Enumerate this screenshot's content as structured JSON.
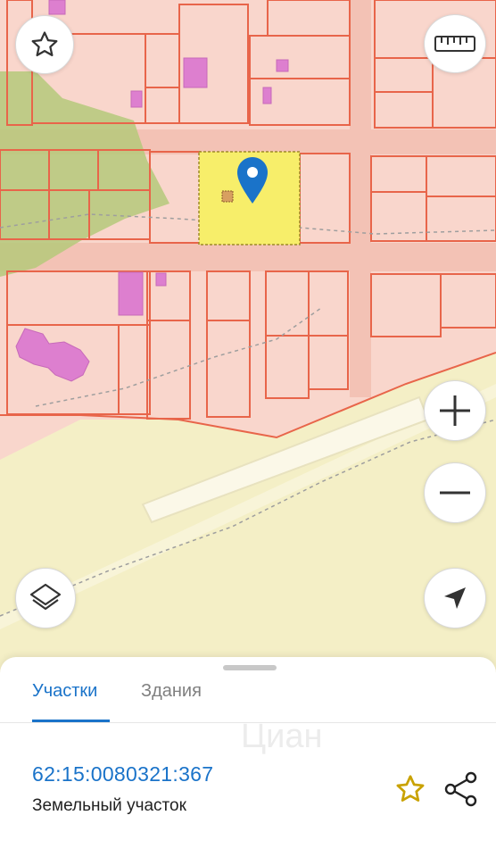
{
  "map": {
    "colors": {
      "background": "#f4efc6",
      "zone": "#f9d6cc",
      "road": "#f3c2b5",
      "plot_border": "#e8654a",
      "green_area": "#b5c97a",
      "building": "#dd7fcf",
      "selected_plot": "#f7ee6a",
      "marker": "#1a73c9",
      "dashed_line": "#9e9e9e"
    },
    "controls": {
      "favorite_icon": "star-outline-icon",
      "ruler_icon": "ruler-icon",
      "zoom_in_icon": "plus-icon",
      "zoom_out_icon": "minus-icon",
      "layers_icon": "layers-icon",
      "locate_icon": "navigation-arrow-icon"
    }
  },
  "sheet": {
    "tabs": [
      {
        "label": "Участки",
        "active": true
      },
      {
        "label": "Здания",
        "active": false
      }
    ],
    "watermark": "Циан",
    "parcel": {
      "number": "62:15:0080321:367",
      "type": "Земельный участок"
    },
    "actions": {
      "favorite_icon": "star-outline-icon",
      "share_icon": "share-icon",
      "favorite_color": "#c9a200"
    }
  }
}
